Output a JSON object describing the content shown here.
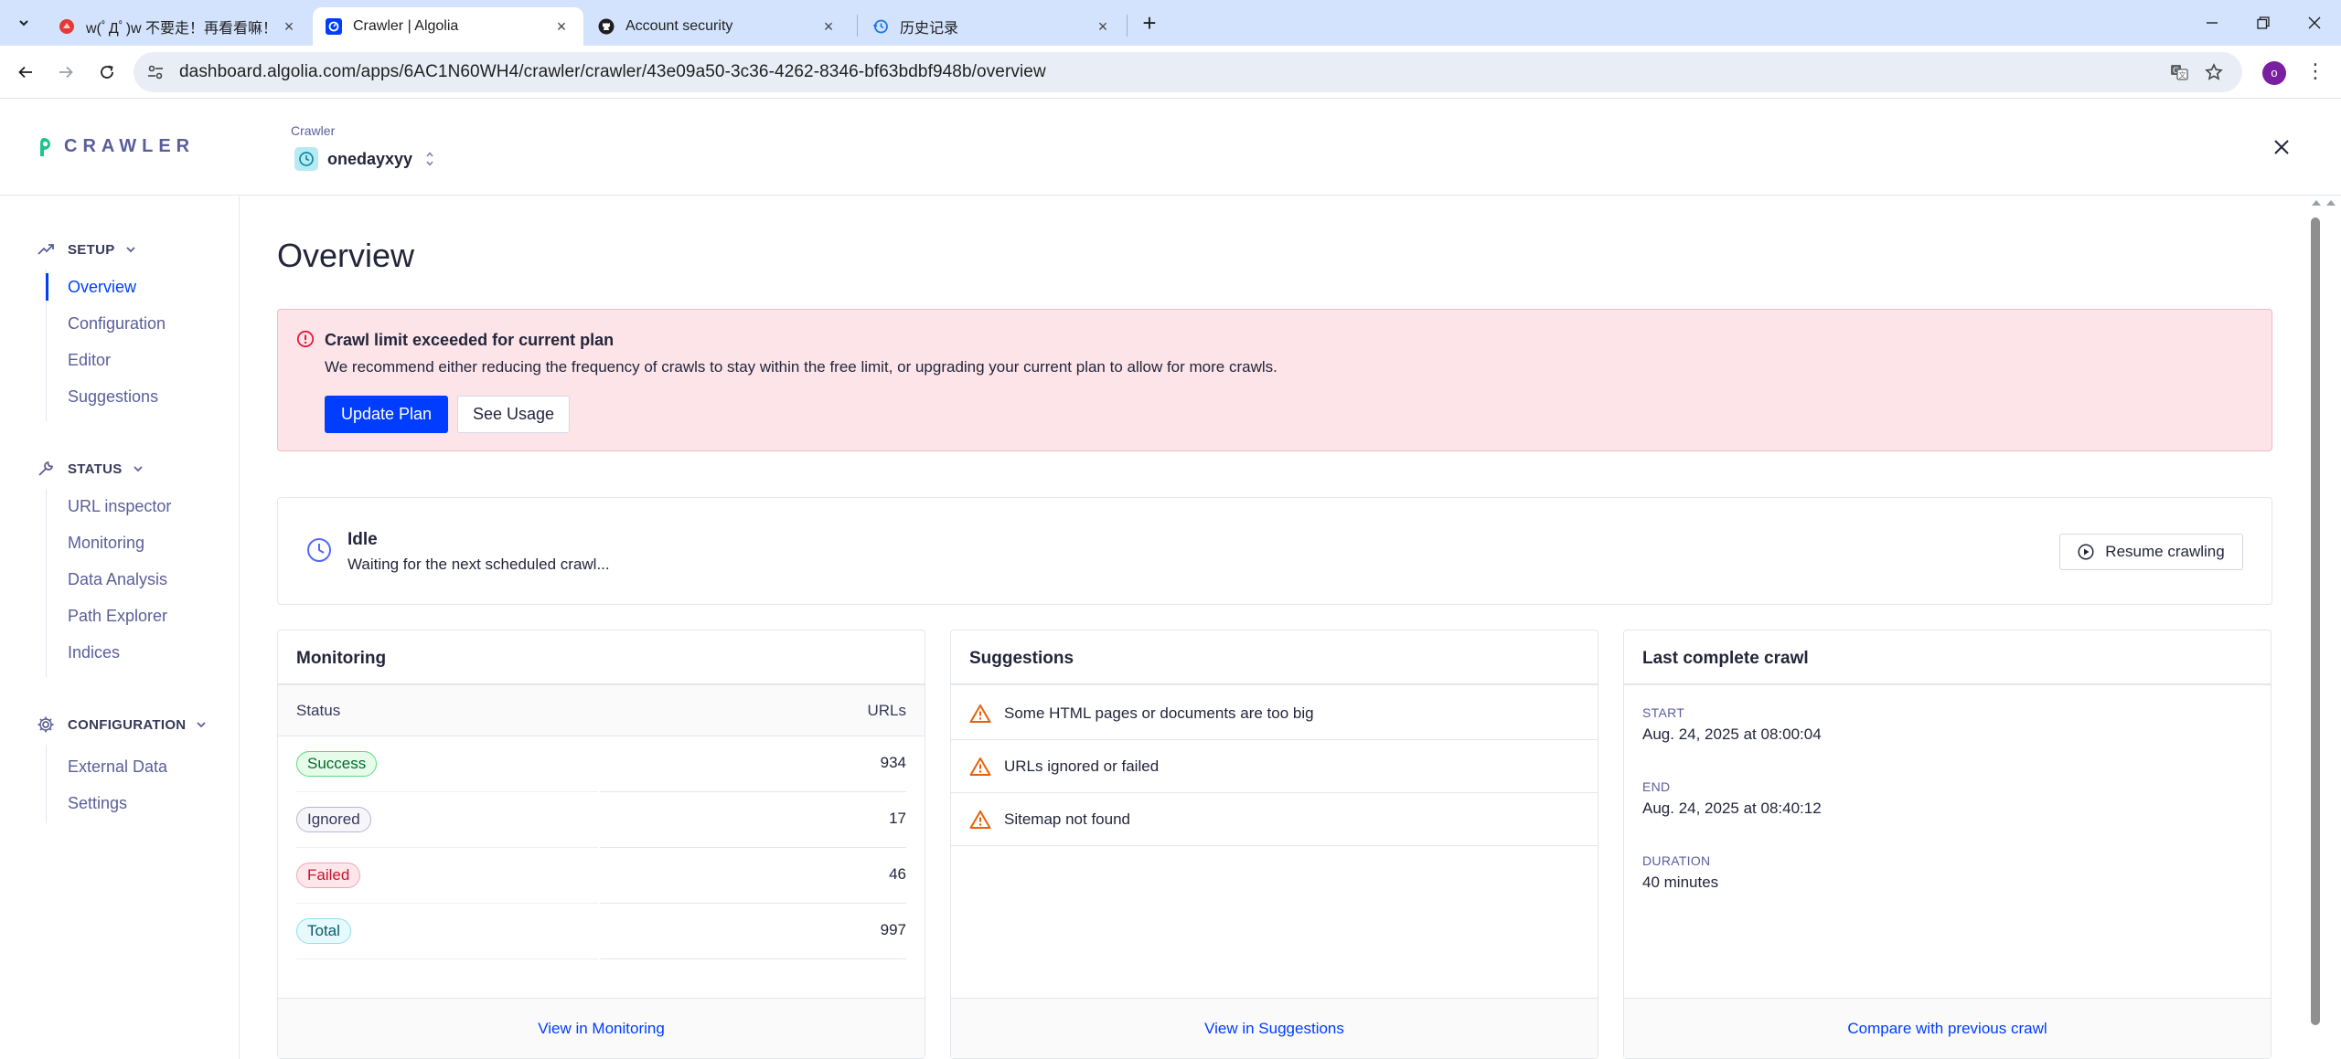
{
  "browser": {
    "tabs": [
      {
        "title": "w(ﾟДﾟ)w 不要走！再看看嘛！",
        "favicon": "red-bird-icon",
        "active": false
      },
      {
        "title": "Crawler | Algolia",
        "favicon": "algolia-icon",
        "active": true
      },
      {
        "title": "Account security",
        "favicon": "github-icon",
        "active": false
      },
      {
        "title": "历史记录",
        "favicon": "history-icon",
        "active": false
      }
    ],
    "url": "dashboard.algolia.com/apps/6AC1N60WH4/crawler/crawler/43e09a50-3c36-4262-8346-bf63bdbf948b/overview",
    "profile_initial": "o"
  },
  "header": {
    "logo_text": "CRAWLER",
    "crawler_label": "Crawler",
    "crawler_name": "onedayxyy"
  },
  "sidebar": {
    "sections": [
      {
        "title": "SETUP",
        "icon": "trend-up-icon",
        "items": [
          "Overview",
          "Configuration",
          "Editor",
          "Suggestions"
        ]
      },
      {
        "title": "STATUS",
        "icon": "wrench-icon",
        "items": [
          "URL inspector",
          "Monitoring",
          "Data Analysis",
          "Path Explorer",
          "Indices"
        ]
      },
      {
        "title": "CONFIGURATION",
        "icon": "gear-icon",
        "items": [
          "External Data",
          "Settings"
        ]
      }
    ],
    "active_item": "Overview"
  },
  "main": {
    "title": "Overview",
    "alert": {
      "title": "Crawl limit exceeded for current plan",
      "text": "We recommend either reducing the frequency of crawls to stay within the free limit, or upgrading your current plan to allow for more crawls.",
      "primary_label": "Update Plan",
      "secondary_label": "See Usage"
    },
    "status": {
      "title": "Idle",
      "text": "Waiting for the next scheduled crawl...",
      "button_label": "Resume crawling"
    },
    "monitoring": {
      "title": "Monitoring",
      "col_status": "Status",
      "col_urls": "URLs",
      "rows": [
        {
          "label": "Success",
          "value": "934",
          "color": "#5adc78"
        },
        {
          "label": "Ignored",
          "value": "17",
          "color": "#b6b7d5"
        },
        {
          "label": "Failed",
          "value": "46",
          "color": "#f4a4b4"
        },
        {
          "label": "Total",
          "value": "997",
          "color": "#8ee1ee"
        }
      ],
      "footer_link": "View in Monitoring"
    },
    "suggestions": {
      "title": "Suggestions",
      "items": [
        "Some HTML pages or documents are too big",
        "URLs ignored or failed",
        "Sitemap not found"
      ],
      "footer_link": "View in Suggestions"
    },
    "last_crawl": {
      "title": "Last complete crawl",
      "start_label": "START",
      "start_value": "Aug. 24, 2025 at 08:00:04",
      "end_label": "END",
      "end_value": "Aug. 24, 2025 at 08:40:12",
      "duration_label": "DURATION",
      "duration_value": "40 minutes",
      "footer_link": "Compare with previous crawl"
    }
  },
  "colors": {
    "accent": "#003dff",
    "alert_bg": "#fde4e8",
    "alert_icon": "#e8173c",
    "warning_icon": "#e8600a"
  }
}
